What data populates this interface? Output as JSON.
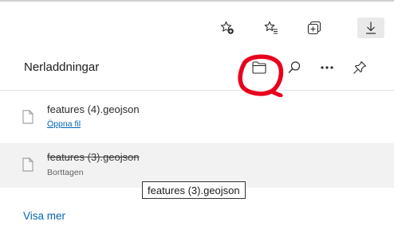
{
  "toolbar": {
    "buttons": [
      {
        "name": "add-favorite-button",
        "icon": "star-plus-icon"
      },
      {
        "name": "favorites-button",
        "icon": "star-list-icon"
      },
      {
        "name": "collections-button",
        "icon": "collections-icon"
      },
      {
        "name": "downloads-button",
        "icon": "download-arrow-icon",
        "active": true
      }
    ]
  },
  "downloads": {
    "title": "Nerladdningar",
    "header_actions": {
      "open_folder_icon": "folder-icon",
      "search_icon": "search-icon",
      "more_icon": "more-ellipsis-icon",
      "pin_icon": "pin-icon"
    },
    "items": [
      {
        "filename": "features (4).geojson",
        "action": "Öppna fil",
        "deleted": false
      },
      {
        "filename": "features (3).geojson",
        "status": "Borttagen",
        "deleted": true
      }
    ],
    "tooltip": "features (3).geojson",
    "show_more": "Visa mer"
  },
  "colors": {
    "link": "#0067b8",
    "annotation": "#e8001c",
    "hover_row": "#f2f2f2"
  }
}
